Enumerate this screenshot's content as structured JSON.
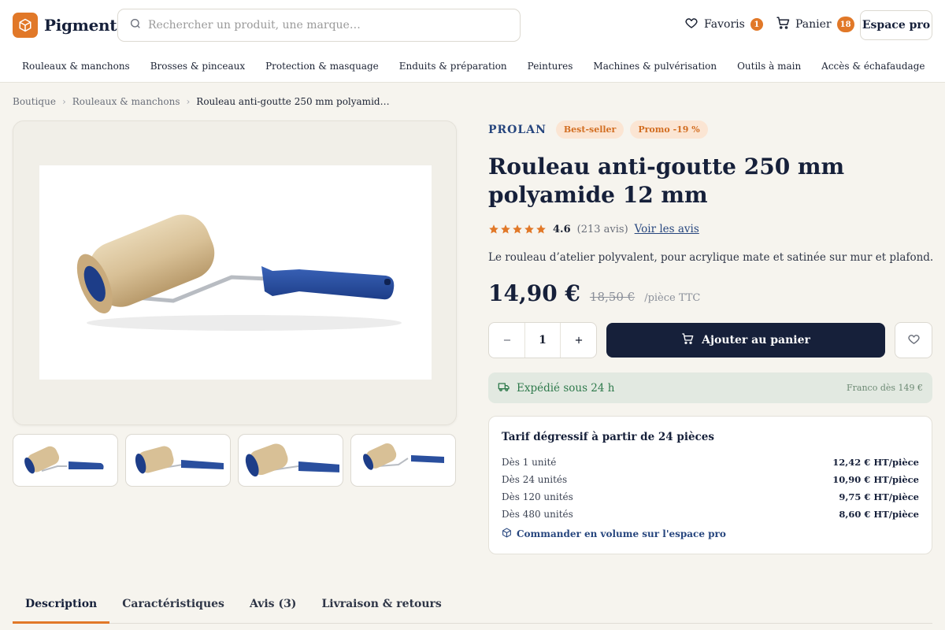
{
  "header": {
    "logo_text": "Pigmento",
    "search_placeholder": "Rechercher un produit, une marque…",
    "favoris_label": "Favoris",
    "favoris_count": "1",
    "panier_label": "Panier",
    "panier_count": "18",
    "espace_pro_label": "Espace pro"
  },
  "categories": [
    "Rouleaux & manchons",
    "Brosses & pinceaux",
    "Protection & masquage",
    "Enduits & préparation",
    "Peintures",
    "Machines & pulvérisation",
    "Outils à main",
    "Accès & échafaudage"
  ],
  "breadcrumb": [
    "Boutique",
    "Rouleaux & manchons",
    "Rouleau anti-goutte 250 mm polyamid…"
  ],
  "product": {
    "brand": "PROLAN",
    "badges": [
      "Best-seller",
      "Promo -19 %"
    ],
    "title": "Rouleau anti-goutte 250 mm polyamide 12 mm",
    "rating": "4.6",
    "rating_stars": 4.6,
    "review_count": "(213 avis)",
    "reviews_link": "Voir les avis",
    "subtitle": "Le rouleau d’atelier polyvalent, pour acrylique mate et satinée sur mur et plafond.",
    "price": "14,90 €",
    "old_price": "18,50 €",
    "unit": "/pièce TTC",
    "quantity": "1",
    "add_to_cart": "Ajouter au panier",
    "shipping": "Expédié sous 24 h",
    "free_shipping": "Franco dès 149 €"
  },
  "tiers": {
    "title": "Tarif dégressif à partir de 24 pièces",
    "rows": [
      {
        "qty": "Dès 1 unité",
        "price": "12,42 € HT/pièce"
      },
      {
        "qty": "Dès 24 unités",
        "price": "10,90 € HT/pièce"
      },
      {
        "qty": "Dès 120 unités",
        "price": "9,75 € HT/pièce"
      },
      {
        "qty": "Dès 480 unités",
        "price": "8,60 € HT/pièce"
      }
    ],
    "link": "Commander en volume sur l'espace pro"
  },
  "tabs": [
    "Description",
    "Caractéristiques",
    "Avis (3)",
    "Livraison & retours"
  ],
  "colors": {
    "accent": "#e17828",
    "navy": "#16203a",
    "link": "#27467e",
    "success": "#2f7a4c"
  },
  "icons": {
    "logo": "box-icon",
    "search": "search-icon",
    "favoris": "heart-icon",
    "panier": "cart-icon",
    "star": "star-icon",
    "truck": "truck-icon",
    "package": "box-icon"
  }
}
